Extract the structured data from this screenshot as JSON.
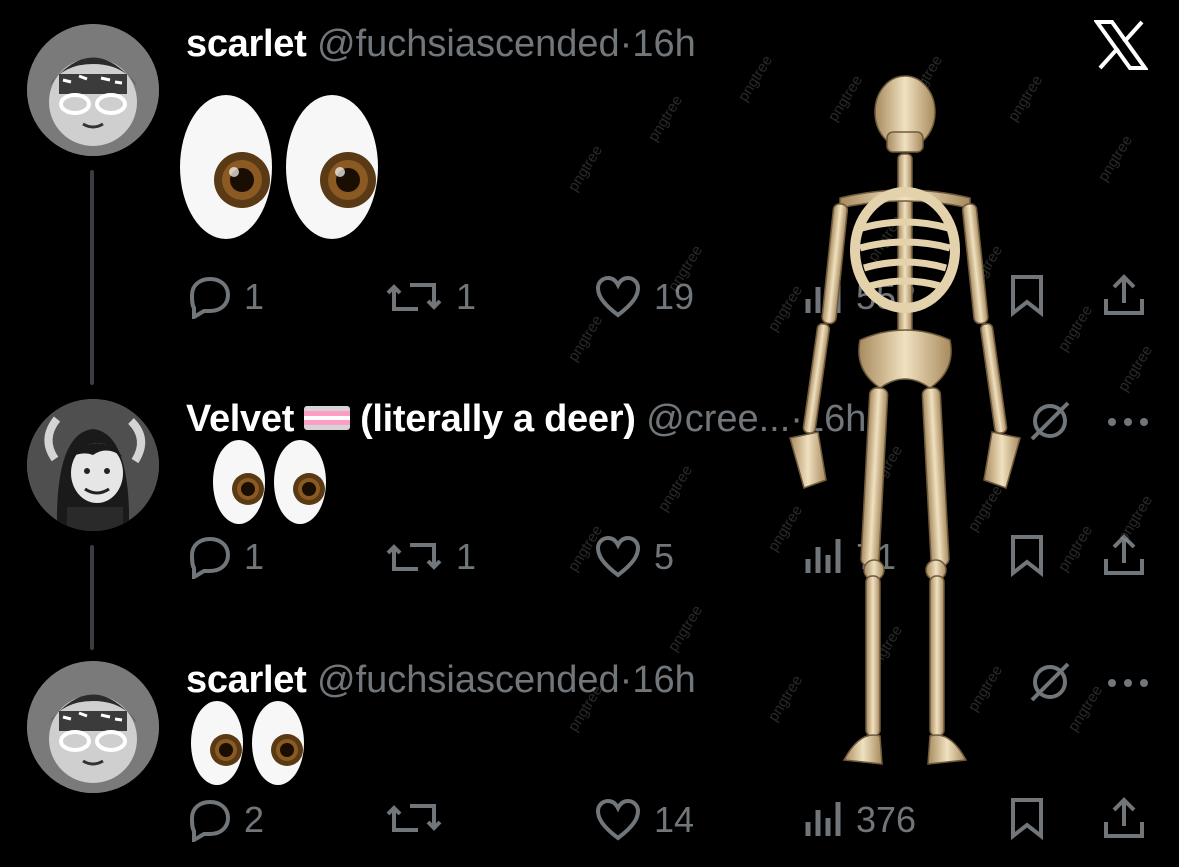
{
  "app": {
    "logo_icon": "x-logo-icon"
  },
  "tweets": [
    {
      "display_name": "scarlet",
      "handle": "@fuchsiascended",
      "separator": "·",
      "time": "16h",
      "content": "👀",
      "actions": {
        "replies": "1",
        "reposts": "1",
        "likes": "19",
        "views": "552"
      }
    },
    {
      "display_name": "Velvet",
      "name_suffix": "(literally a deer)",
      "handle": "@cree...",
      "separator": "·",
      "time": "16h",
      "content": "👀",
      "actions": {
        "replies": "1",
        "reposts": "1",
        "likes": "5",
        "views": "71"
      },
      "flag_colors": [
        "#d5d5d5",
        "#ff9ec4",
        "#ffffff",
        "#ff9ec4",
        "#d5d5d5"
      ]
    },
    {
      "display_name": "scarlet",
      "handle": "@fuchsiascended",
      "separator": "·",
      "time": "16h",
      "content": "👀",
      "actions": {
        "replies": "2",
        "reposts": "",
        "likes": "14",
        "views": "376"
      }
    }
  ],
  "icons": {
    "reply": "reply-icon",
    "repost": "repost-icon",
    "like": "heart-icon",
    "views": "views-icon",
    "bookmark": "bookmark-icon",
    "share": "share-icon",
    "grok": "grok-icon",
    "more": "more-icon"
  },
  "overlay": {
    "image": "skeleton-image",
    "watermark": "pngtree"
  },
  "colors": {
    "background": "#000000",
    "text": "#e7e9ea",
    "muted": "#71767b",
    "thread_line": "#3a3d41"
  }
}
